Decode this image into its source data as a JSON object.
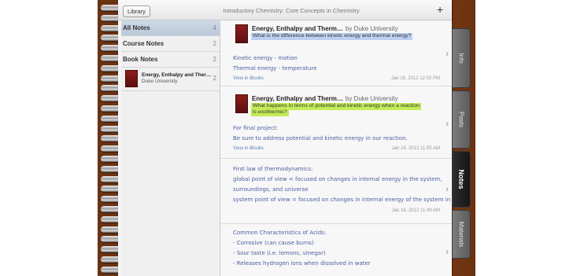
{
  "header": {
    "library_label": "Library",
    "book_title": "Introductory Chemistry: Core Concepts in Chemistry",
    "add_icon": "+"
  },
  "sidebar": {
    "items": [
      {
        "label": "All Notes",
        "count": "4",
        "active": true
      },
      {
        "label": "Course Notes",
        "count": "2"
      },
      {
        "label": "Book Notes",
        "count": "2"
      }
    ],
    "book": {
      "title": "Energy, Enthalpy and Ther…",
      "author": "Duke University",
      "count": "2"
    }
  },
  "notes": [
    {
      "title": "Energy, Enthalpy and Therm…",
      "by": "by Duke University",
      "highlight": "What is the difference between kinetic energy and thermal energy?",
      "highlight_color": "#bcd0f3",
      "lines": [
        "Kinetic energy - motion",
        "Thermal energy - temperature"
      ],
      "view_label": "View in iBooks",
      "date": "Jan 16, 2012 12:02 PM"
    },
    {
      "title": "Energy, Enthalpy and Therm…",
      "by": "by Duke University",
      "highlight_line1": "What happens in terms of potential and kinetic energy when a reaction",
      "highlight_line2": "is exothermic?",
      "highlight_color": "#c4ec58",
      "lines": [
        "For final project:",
        "Be sure to address potential and kinetic energy in our reaction."
      ],
      "view_label": "View in iBooks",
      "date": "Jan 16, 2012 11:55 AM"
    },
    {
      "lines": [
        "First law of thermodynamics:",
        "global point of view = focused on changes in internal energy in the system,",
        "surroundings, and universe",
        "system point of view = focused on changes in internal energy of the system in rela…"
      ],
      "date": "Jan 16, 2012 11:49 AM"
    },
    {
      "lines": [
        "Common Characteristics of Acids:",
        "- Corrosive (can cause burns)",
        "- Sour taste (i.e. lemons, vinegar)",
        "- Releases hydrogen ions when dissolved in water"
      ]
    }
  ],
  "chevron_icon": "›",
  "tabs": [
    {
      "label": "Info"
    },
    {
      "label": "Posts"
    },
    {
      "label": "Notes",
      "active": true
    },
    {
      "label": "Materials"
    }
  ]
}
